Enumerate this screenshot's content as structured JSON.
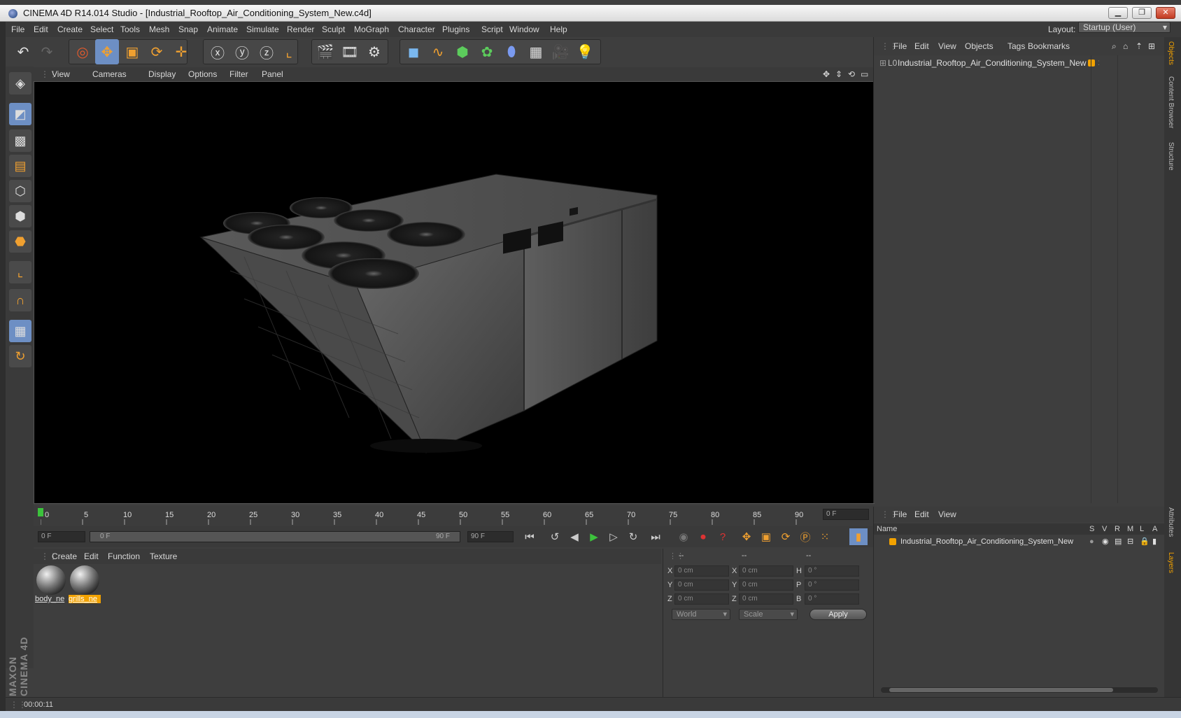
{
  "window": {
    "title": "CINEMA 4D R14.014 Studio - [Industrial_Rooftop_Air_Conditioning_System_New.c4d]"
  },
  "menubar": {
    "items": [
      "File",
      "Edit",
      "Create",
      "Select",
      "Tools",
      "Mesh",
      "Snap",
      "Animate",
      "Simulate",
      "Render",
      "Sculpt",
      "MoGraph",
      "Character",
      "Plugins",
      "Script",
      "Window",
      "Help"
    ],
    "layout_label": "Layout:",
    "layout_value": "Startup (User)"
  },
  "viewport": {
    "menu": [
      "View",
      "Cameras",
      "Display",
      "Options",
      "Filter",
      "Panel"
    ]
  },
  "timeline": {
    "ticks": [
      "0",
      "5",
      "10",
      "15",
      "20",
      "25",
      "30",
      "35",
      "40",
      "45",
      "50",
      "55",
      "60",
      "65",
      "70",
      "75",
      "80",
      "85",
      "90"
    ],
    "current_frame": "0 F",
    "start_field": "0 F",
    "range_start": "0 F",
    "range_end": "90 F",
    "end_field": "90 F"
  },
  "material_manager": {
    "menu": [
      "Create",
      "Edit",
      "Function",
      "Texture"
    ],
    "materials": [
      {
        "label": "body_ne"
      },
      {
        "label": "grills_ne"
      }
    ]
  },
  "coordinates": {
    "headers": [
      "--",
      "--",
      "--"
    ],
    "rows": [
      {
        "axis1": "X",
        "pos": "0 cm",
        "axis2": "X",
        "size": "0 cm",
        "axis3": "H",
        "rot": "0 °"
      },
      {
        "axis1": "Y",
        "pos": "0 cm",
        "axis2": "Y",
        "size": "0 cm",
        "axis3": "P",
        "rot": "0 °"
      },
      {
        "axis1": "Z",
        "pos": "0 cm",
        "axis2": "Z",
        "size": "0 cm",
        "axis3": "B",
        "rot": "0 °"
      }
    ],
    "mode": "World",
    "transform": "Scale",
    "apply": "Apply"
  },
  "object_manager": {
    "menu": [
      "File",
      "Edit",
      "View",
      "Objects",
      "Tags",
      "Bookmarks"
    ],
    "objects": [
      {
        "name": "Industrial_Rooftop_Air_Conditioning_System_New"
      }
    ]
  },
  "layer_manager": {
    "menu": [
      "File",
      "Edit",
      "View"
    ],
    "column_name": "Name",
    "columns": [
      "S",
      "V",
      "R",
      "M",
      "L",
      "A"
    ],
    "layers": [
      {
        "name": "Industrial_Rooftop_Air_Conditioning_System_New"
      }
    ]
  },
  "right_tabs": [
    "Objects",
    "Content Browser",
    "Structure",
    "Attributes",
    "Layers"
  ],
  "status": {
    "time": "00:00:11"
  },
  "brand": "MAXON CINEMA 4D",
  "colors": {
    "accent": "#f2a200",
    "selection": "#6d8fc4",
    "play": "#3cc23c"
  }
}
